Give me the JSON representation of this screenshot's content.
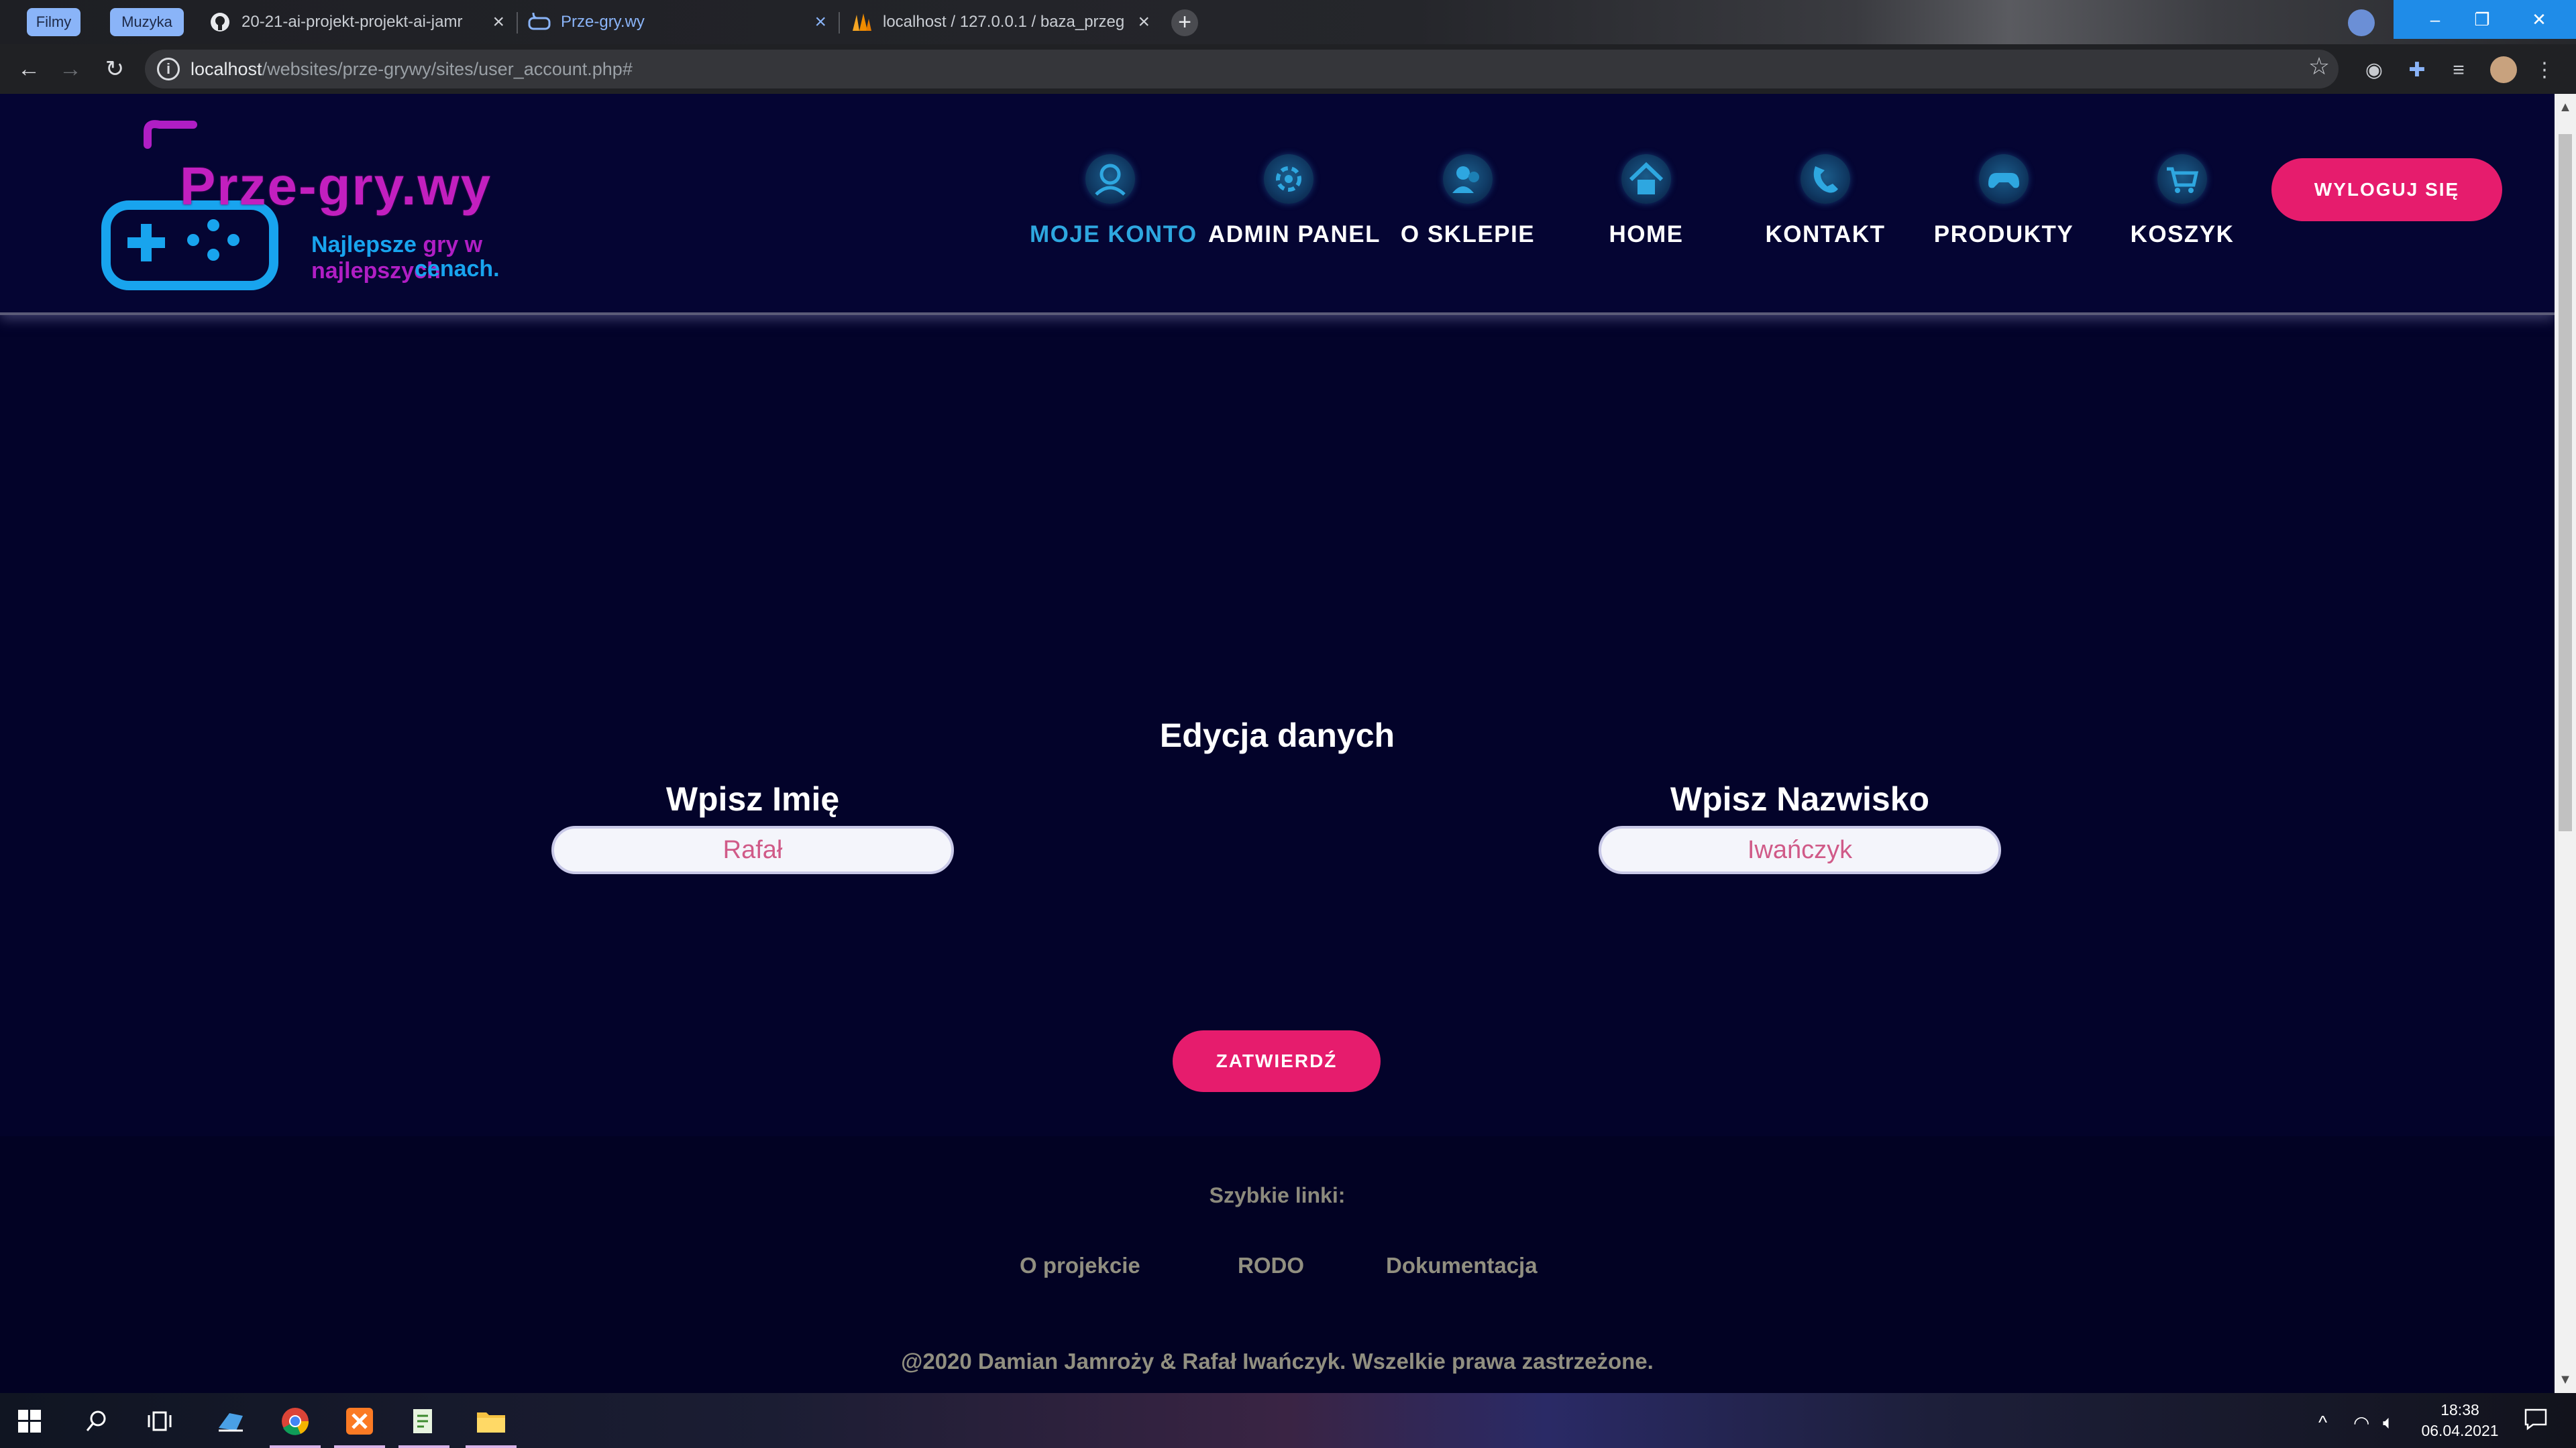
{
  "browser": {
    "bookmarks": [
      {
        "label": "Filmy"
      },
      {
        "label": "Muzyka"
      }
    ],
    "tabs": [
      {
        "label": "20-21-ai-projekt-projekt-ai-jamr",
        "icon": "github-icon"
      },
      {
        "label": "Prze-gry.wy",
        "icon": "gamepad-icon",
        "active": true
      },
      {
        "label": "localhost / 127.0.0.1 / baza_przeg",
        "icon": "phpmyadmin-icon"
      }
    ],
    "new_tab": "+",
    "window_controls": {
      "minimize": "–",
      "restore": "❐",
      "close": "✕"
    },
    "url_host": "localhost",
    "url_path": "/websites/prze-grywy/sites/user_account.php#"
  },
  "site": {
    "logo": {
      "title": "Prze-gry.wy",
      "tagline_line1_a": "Najlepsze ",
      "tagline_line1_b": "gry w najlepszych",
      "tagline_line2": "cenach."
    },
    "nav": [
      {
        "label": "MOJE KONTO",
        "icon": "user-account-icon",
        "current": true
      },
      {
        "label": "ADMIN PANEL",
        "icon": "admin-panel-icon"
      },
      {
        "label": "O SKLEPIE",
        "icon": "about-shop-icon"
      },
      {
        "label": "HOME",
        "icon": "home-icon"
      },
      {
        "label": "KONTAKT",
        "icon": "phone-icon"
      },
      {
        "label": "PRODUKTY",
        "icon": "gamepad-icon"
      },
      {
        "label": "KOSZYK",
        "icon": "cart-icon"
      }
    ],
    "logout_label": "WYLOGUJ SIĘ",
    "colors": {
      "accent": "#e61c6d",
      "nav_active": "#2ea7e0",
      "background": "#03032a"
    }
  },
  "form": {
    "title": "Edycja danych",
    "first_name_label": "Wpisz Imię",
    "first_name_placeholder": "Rafał",
    "last_name_label": "Wpisz Nazwisko",
    "last_name_placeholder": "Iwańczyk",
    "submit_label": "ZATWIERDŹ"
  },
  "footer": {
    "quick_links_title": "Szybkie linki:",
    "links": [
      "O projekcie",
      "RODO",
      "Dokumentacja"
    ],
    "copyright": "@2020 Damian Jamroży & Rafał Iwańczyk. Wszelkie prawa zastrzeżone."
  },
  "taskbar": {
    "apps": [
      "windows-start-icon",
      "search-icon",
      "task-view-icon",
      "file-explorer-pinned-icon",
      "chrome-icon",
      "xampp-icon",
      "notepad-icon",
      "folder-icon"
    ],
    "time": "18:38",
    "date": "06.04.2021"
  }
}
